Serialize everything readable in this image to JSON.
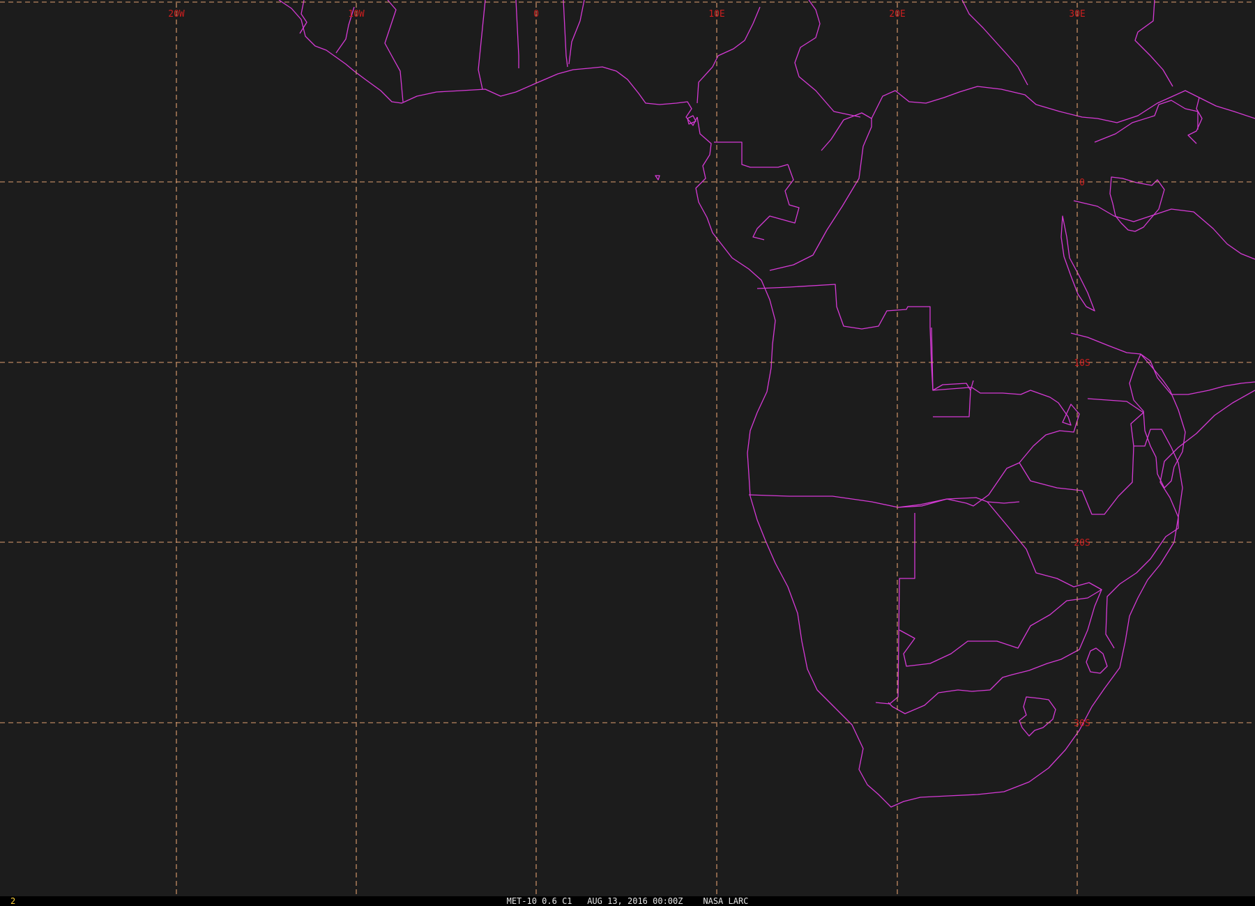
{
  "map": {
    "longitude_labels": [
      "20W",
      "10W",
      "0",
      "10E",
      "20E",
      "30E"
    ],
    "latitude_labels": [
      "0",
      "10S",
      "20S",
      "30S"
    ],
    "colors": {
      "background": "#1c1c1c",
      "boundaries": "#d63ad6",
      "grid": "#e0a070",
      "grid_labels": "#cc1f1f"
    }
  },
  "status_bar": {
    "frame_number": "2",
    "caption": "MET-10 0.6 C1   AUG 13, 2016 00:00Z    NASA LARC"
  }
}
